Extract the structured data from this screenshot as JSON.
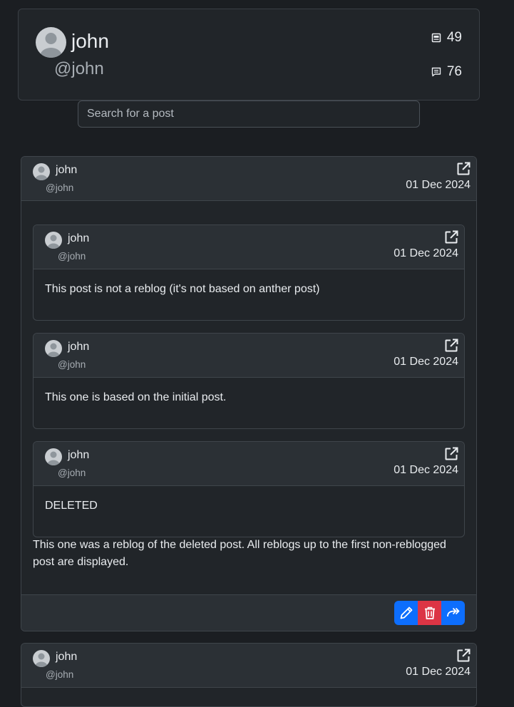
{
  "profile": {
    "name": "john",
    "handle": "@john",
    "posts_count": "49",
    "comments_count": "76"
  },
  "search": {
    "placeholder": "Search for a post"
  },
  "posts": [
    {
      "author": "john",
      "handle": "@john",
      "date": "01 Dec 2024",
      "text": "This one was a reblog of the deleted post. All reblogs up to the first non-reblogged post are displayed.",
      "reblogs": [
        {
          "author": "john",
          "handle": "@john",
          "date": "01 Dec 2024",
          "text": "This post is not a reblog (it's not based on anther post)"
        },
        {
          "author": "john",
          "handle": "@john",
          "date": "01 Dec 2024",
          "text": "This one is based on the initial post."
        },
        {
          "author": "john",
          "handle": "@john",
          "date": "01 Dec 2024",
          "text": "DELETED"
        }
      ]
    },
    {
      "author": "john",
      "handle": "@john",
      "date": "01 Dec 2024"
    }
  ],
  "icons": {
    "posts": "card-icon",
    "comments": "comment-icon",
    "open": "external-link-icon",
    "edit": "pencil-icon",
    "delete": "trash-icon",
    "reblog": "reblog-arrow-icon"
  },
  "colors": {
    "primary": "#0d6efd",
    "danger": "#dc3545",
    "background": "#1b1e22",
    "card": "#212529"
  }
}
